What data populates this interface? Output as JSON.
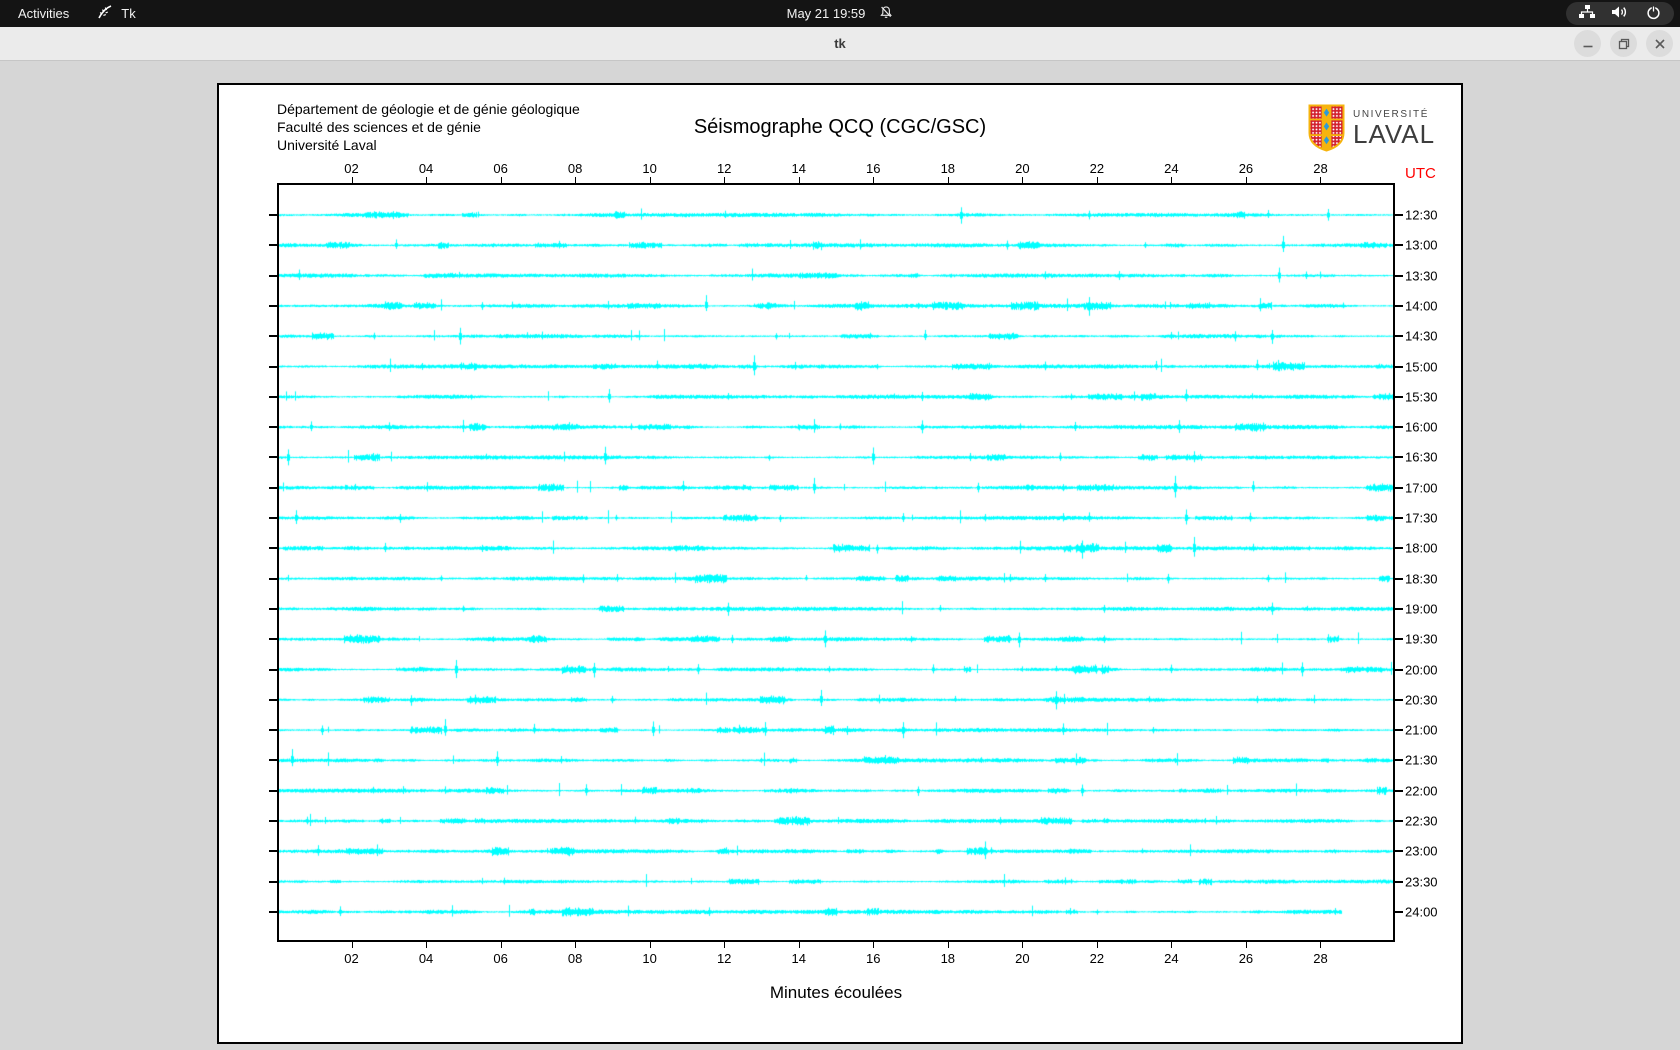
{
  "system_bar": {
    "activities_label": "Activities",
    "app_name": "Tk",
    "clock": "May 21  19:59",
    "icons": [
      "tk-feather-icon",
      "bell-slash-icon",
      "network-wired-icon",
      "volume-icon",
      "power-icon"
    ]
  },
  "window": {
    "title": "tk",
    "controls": [
      "minimize",
      "maximize",
      "close"
    ]
  },
  "seismograph": {
    "header_lines": [
      "Département de géologie et de génie géologique",
      "Faculté des sciences et de génie",
      "Université Laval"
    ],
    "title": "Séismographe QCQ (CGC/GSC)",
    "logo": {
      "line1": "UNIVERSITÉ",
      "line2": "LAVAL"
    },
    "utc_label": "UTC",
    "xlabel": "Minutes écoulées",
    "colors": {
      "trace": "#00ffff",
      "axis": "#000000",
      "utc": "#ff0000",
      "logo_red": "#d21f2f",
      "logo_gold": "#f6b40e",
      "logo_blue": "#2e9bd6"
    },
    "x_axis_minutes_range": [
      0,
      30
    ],
    "x_ticks": [
      "02",
      "04",
      "06",
      "08",
      "10",
      "12",
      "14",
      "16",
      "18",
      "20",
      "22",
      "24",
      "26",
      "28"
    ],
    "rows": [
      {
        "label": "12:30",
        "spikes": [
          [
            3.1,
            5
          ],
          [
            18.35,
            13
          ],
          [
            21.8,
            6
          ],
          [
            26.6,
            5
          ],
          [
            28.2,
            7
          ]
        ]
      },
      {
        "label": "13:00",
        "spikes": [
          [
            3.2,
            6
          ],
          [
            19.6,
            5
          ],
          [
            23.3,
            4
          ],
          [
            27.0,
            12
          ]
        ]
      },
      {
        "label": "13:30",
        "spikes": [
          [
            0.6,
            7
          ],
          [
            14.9,
            4
          ],
          [
            20.6,
            6
          ],
          [
            22.6,
            5
          ],
          [
            26.9,
            10
          ],
          [
            27.6,
            6
          ]
        ]
      },
      {
        "label": "14:00",
        "spikes": [
          [
            5.5,
            6
          ],
          [
            11.5,
            11
          ],
          [
            17.2,
            4
          ],
          [
            21.8,
            13
          ],
          [
            25.0,
            4
          ],
          [
            28.6,
            5
          ]
        ]
      },
      {
        "label": "14:30",
        "spikes": [
          [
            2.6,
            5
          ],
          [
            4.9,
            12
          ],
          [
            6.7,
            5
          ],
          [
            13.4,
            4
          ],
          [
            17.4,
            7
          ],
          [
            24.0,
            5
          ],
          [
            25.7,
            8
          ],
          [
            26.7,
            9
          ]
        ]
      },
      {
        "label": "15:00",
        "spikes": [
          [
            3.9,
            4
          ],
          [
            10.2,
            6
          ],
          [
            12.8,
            12
          ],
          [
            16.1,
            4
          ],
          [
            20.6,
            5
          ],
          [
            23.6,
            6
          ],
          [
            26.3,
            7
          ]
        ]
      },
      {
        "label": "15:30",
        "spikes": [
          [
            5.2,
            4
          ],
          [
            8.9,
            8
          ],
          [
            12.1,
            5
          ],
          [
            17.3,
            5
          ],
          [
            21.3,
            4
          ],
          [
            24.4,
            9
          ]
        ]
      },
      {
        "label": "16:00",
        "spikes": [
          [
            0.9,
            6
          ],
          [
            3.0,
            5
          ],
          [
            9.5,
            4
          ],
          [
            15.1,
            5
          ],
          [
            17.3,
            10
          ],
          [
            21.4,
            6
          ],
          [
            24.2,
            7
          ],
          [
            27.1,
            4
          ]
        ]
      },
      {
        "label": "16:30",
        "spikes": [
          [
            0.3,
            9
          ],
          [
            5.6,
            4
          ],
          [
            8.8,
            11
          ],
          [
            13.2,
            4
          ],
          [
            16.0,
            10
          ],
          [
            18.6,
            6
          ],
          [
            21.0,
            5
          ],
          [
            24.6,
            7
          ]
        ]
      },
      {
        "label": "17:00",
        "spikes": [
          [
            2.1,
            4
          ],
          [
            7.3,
            5
          ],
          [
            10.9,
            7
          ],
          [
            14.4,
            11
          ],
          [
            18.8,
            6
          ],
          [
            21.1,
            5
          ],
          [
            24.1,
            16
          ],
          [
            26.2,
            7
          ]
        ]
      },
      {
        "label": "17:30",
        "spikes": [
          [
            0.5,
            12
          ],
          [
            3.3,
            6
          ],
          [
            9.1,
            4
          ],
          [
            13.5,
            5
          ],
          [
            16.8,
            6
          ],
          [
            19.0,
            4
          ],
          [
            21.8,
            7
          ],
          [
            24.4,
            11
          ],
          [
            26.1,
            6
          ]
        ]
      },
      {
        "label": "18:00",
        "spikes": [
          [
            1.2,
            4
          ],
          [
            2.9,
            7
          ],
          [
            5.5,
            5
          ],
          [
            10.7,
            4
          ],
          [
            16.1,
            6
          ],
          [
            21.6,
            12
          ],
          [
            24.6,
            13
          ],
          [
            26.2,
            5
          ],
          [
            27.7,
            4
          ]
        ]
      },
      {
        "label": "18:30",
        "spikes": [
          [
            4.4,
            4
          ],
          [
            8.2,
            5
          ],
          [
            14.2,
            4
          ],
          [
            20.6,
            6
          ],
          [
            23.9,
            7
          ],
          [
            26.6,
            5
          ]
        ]
      },
      {
        "label": "19:00",
        "spikes": [
          [
            5.0,
            4
          ],
          [
            12.1,
            10
          ],
          [
            17.8,
            4
          ],
          [
            22.2,
            6
          ],
          [
            26.7,
            9
          ]
        ]
      },
      {
        "label": "19:30",
        "spikes": [
          [
            5.8,
            4
          ],
          [
            12.2,
            6
          ],
          [
            14.7,
            10
          ],
          [
            17.0,
            5
          ],
          [
            19.9,
            11
          ],
          [
            22.2,
            6
          ],
          [
            28.2,
            5
          ]
        ]
      },
      {
        "label": "20:00",
        "spikes": [
          [
            4.8,
            11
          ],
          [
            8.5,
            10
          ],
          [
            11.3,
            7
          ],
          [
            14.8,
            4
          ],
          [
            17.6,
            6
          ],
          [
            20.9,
            4
          ],
          [
            24.0,
            5
          ],
          [
            27.5,
            8
          ]
        ]
      },
      {
        "label": "20:30",
        "spikes": [
          [
            3.6,
            7
          ],
          [
            5.3,
            6
          ],
          [
            9.0,
            4
          ],
          [
            14.6,
            10
          ],
          [
            18.2,
            4
          ],
          [
            20.9,
            11
          ],
          [
            23.4,
            5
          ],
          [
            26.3,
            6
          ]
        ]
      },
      {
        "label": "21:00",
        "spikes": [
          [
            1.2,
            6
          ],
          [
            4.5,
            11
          ],
          [
            6.9,
            7
          ],
          [
            10.1,
            10
          ],
          [
            15.3,
            6
          ],
          [
            16.8,
            9
          ],
          [
            21.1,
            7
          ],
          [
            23.5,
            4
          ]
        ]
      },
      {
        "label": "21:30",
        "spikes": [
          [
            0.4,
            12
          ],
          [
            5.9,
            10
          ],
          [
            13.0,
            4
          ],
          [
            18.9,
            4
          ],
          [
            24.1,
            3
          ]
        ]
      },
      {
        "label": "22:00",
        "spikes": [
          [
            8.3,
            8
          ],
          [
            11.0,
            4
          ],
          [
            17.2,
            6
          ],
          [
            21.6,
            10
          ],
          [
            25.3,
            3
          ]
        ]
      },
      {
        "label": "22:30",
        "spikes": [
          [
            0.8,
            6
          ],
          [
            9.6,
            5
          ],
          [
            14.2,
            3
          ],
          [
            19.4,
            4
          ],
          [
            24.9,
            4
          ]
        ]
      },
      {
        "label": "23:00",
        "spikes": [
          [
            1.1,
            8
          ],
          [
            7.8,
            3
          ],
          [
            19.0,
            11
          ],
          [
            23.2,
            3
          ]
        ]
      },
      {
        "label": "23:30",
        "spikes": [
          [
            6.1,
            4
          ],
          [
            12.6,
            4
          ],
          [
            21.3,
            3
          ]
        ]
      },
      {
        "label": "24:00",
        "end": 28.6,
        "spikes": [
          [
            1.7,
            6
          ],
          [
            11.6,
            5
          ],
          [
            17.5,
            3
          ],
          [
            22.0,
            4
          ],
          [
            27.3,
            3
          ],
          [
            28.4,
            5
          ]
        ]
      }
    ]
  }
}
